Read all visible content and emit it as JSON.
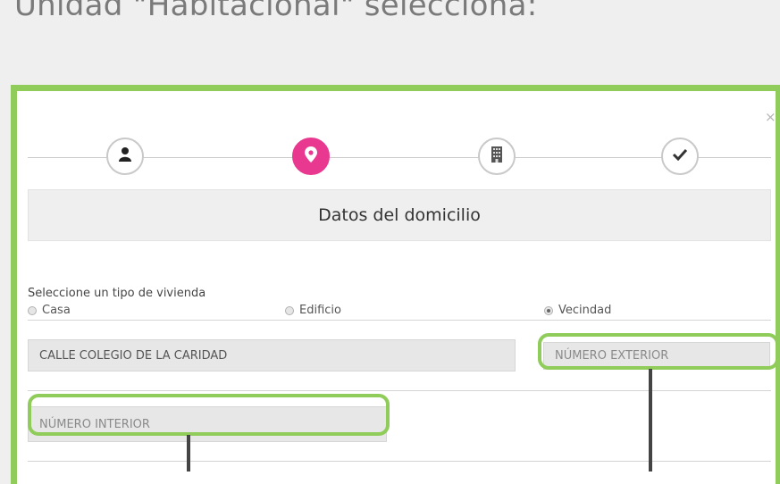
{
  "page": {
    "heading": "Unidad \"Habitacional\" selecciona:"
  },
  "dialog": {
    "close_label": "×",
    "steps": [
      {
        "icon": "user-icon",
        "active": false
      },
      {
        "icon": "location-pin-icon",
        "active": true
      },
      {
        "icon": "building-icon",
        "active": false
      },
      {
        "icon": "checkmark-icon",
        "active": false
      }
    ],
    "section_title": "Datos del domicilio",
    "housing_type": {
      "label": "Seleccione un tipo de vivienda",
      "options": [
        "Casa",
        "Edificio",
        "Vecindad"
      ],
      "selected": "Vecindad"
    },
    "street_value": "CALLE COLEGIO DE LA CARIDAD",
    "exterior_number_placeholder": "NÚMERO EXTERIOR",
    "interior_number_placeholder": "NÚMERO INTERIOR"
  },
  "colors": {
    "highlight": "#8fcc5a",
    "active_step": "#e8388f"
  }
}
